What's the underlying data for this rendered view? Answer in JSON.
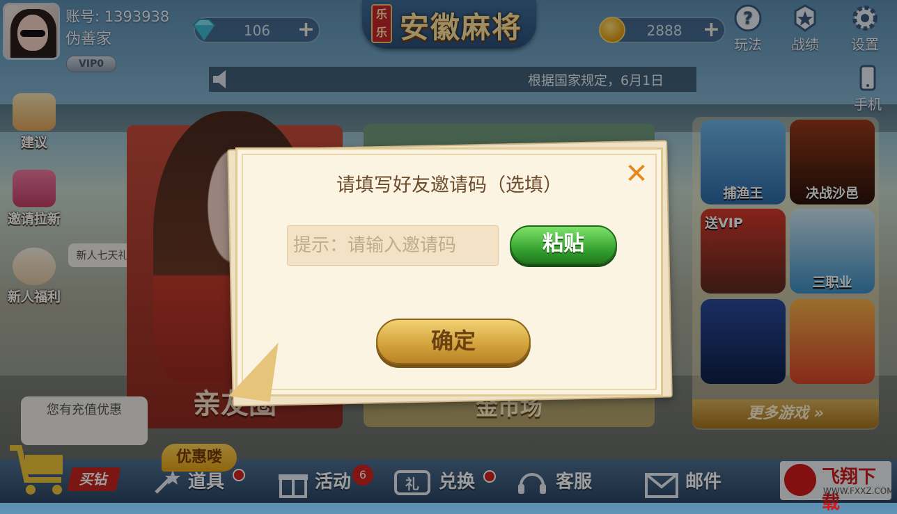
{
  "profile": {
    "account": "账号: 1393938",
    "nickname": "伪善家",
    "vip": "VIP0"
  },
  "currency": {
    "diamonds": "106",
    "coins": "2888"
  },
  "header": {
    "brand_badge": "乐乐",
    "title": "安徽麻将"
  },
  "top_icons": [
    {
      "label": "玩法",
      "icon": "help-icon"
    },
    {
      "label": "战绩",
      "icon": "star-badge-icon"
    },
    {
      "label": "设置",
      "icon": "gear-icon"
    }
  ],
  "phone": {
    "label": "手机"
  },
  "notice": {
    "text": "根据国家规定，6月1日"
  },
  "left_menu": [
    {
      "label": "建议"
    },
    {
      "label": "邀请拉新"
    },
    {
      "label": "新人福利"
    }
  ],
  "bubbles": {
    "new_user": "新人七天礼",
    "recharge": "您有充值优惠"
  },
  "panels": {
    "friends": "亲友圈",
    "gold": "金币场"
  },
  "games": [
    {
      "label": "捕渔王"
    },
    {
      "label": "决战沙邑"
    },
    {
      "label": "送VIP"
    },
    {
      "label": "三职业"
    },
    {
      "label": ""
    },
    {
      "label": ""
    }
  ],
  "more_games": "更多游戏 »",
  "bottom_bar": {
    "buy": "买钻",
    "promo": "优惠喽",
    "items": "道具",
    "activity": "活动",
    "activity_badge": "6",
    "exchange": "兑换",
    "service": "客服",
    "mail": "邮件"
  },
  "dialog": {
    "title": "请填写好友邀请码（选填）",
    "close": "✕",
    "placeholder": "提示：请输入邀请码",
    "paste": "粘贴",
    "confirm": "确定"
  },
  "watermark": {
    "name": "飞翔下载",
    "url": "WWW.FXXZ.COM"
  },
  "colors": {
    "dialog_bg": "#fbf4e3",
    "paste_green": "#2f9b2a",
    "confirm_gold": "#d1a03a",
    "close_orange": "#e8871f"
  }
}
